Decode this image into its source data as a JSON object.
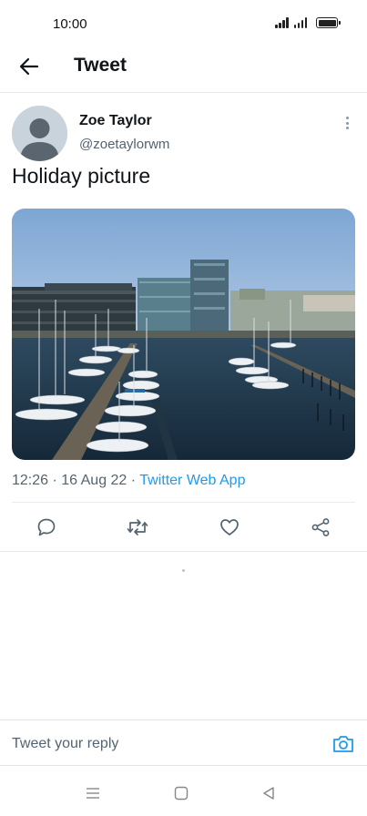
{
  "status_bar": {
    "time": "10:00"
  },
  "header": {
    "title": "Tweet",
    "back_icon": "arrow-left-icon"
  },
  "tweet": {
    "author_name": "Zoe Taylor",
    "author_handle": "@zoetaylorwm",
    "text": "Holiday picture",
    "timestamp": "12:26 · 16 Aug 22 · ",
    "source": "Twitter Web App",
    "media_description": "harbour-marina-photo"
  },
  "actions": {
    "reply_icon": "comment-icon",
    "retweet_icon": "retweet-icon",
    "like_icon": "heart-icon",
    "share_icon": "share-icon"
  },
  "reply": {
    "placeholder": "Tweet your reply",
    "camera_icon": "camera-icon"
  },
  "colors": {
    "accent": "#1d9bf0",
    "secondary_text": "#536471",
    "primary_text": "#0f1419",
    "divider": "#e9ecef"
  }
}
